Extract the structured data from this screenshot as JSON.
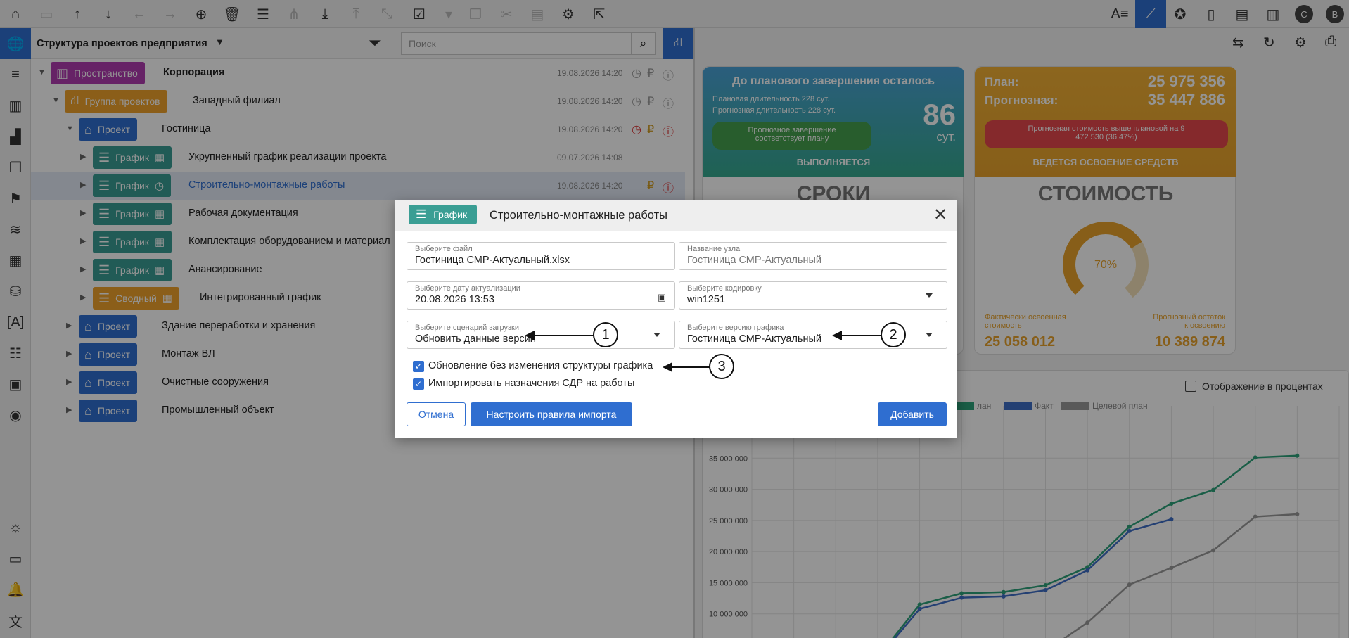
{
  "toolbar": {
    "icons": [
      "home-icon",
      "open-folder-icon",
      "move-up-icon",
      "move-down-icon",
      "undo-icon",
      "redo-icon",
      "add-icon",
      "delete-icon",
      "settings-sliders-icon",
      "hierarchy-icon",
      "download-icon",
      "upload-icon",
      "collapse-icon",
      "checkbox-icon",
      "copy-icon",
      "cut-icon",
      "paste-icon",
      "tools-icon",
      "export-icon"
    ],
    "right_badges": [
      "C",
      "B"
    ]
  },
  "tree_panel": {
    "selector_label": "Структура проектов предприятия",
    "search_placeholder": "Поиск",
    "rows": [
      {
        "type": "Пространство",
        "label": "Корпорация",
        "date": "19.08.2026 14:20",
        "bold": true
      },
      {
        "type": "Группа проектов",
        "label": "Западный филиал",
        "date": "19.08.2026 14:20"
      },
      {
        "type": "Проект",
        "label": "Гостиница",
        "date": "19.08.2026 14:20"
      },
      {
        "type": "График",
        "label": "Укрупненный график реализации проекта",
        "date": "09.07.2026 14:08"
      },
      {
        "type": "График",
        "label": "Строительно-монтажные работы",
        "date": "19.08.2026 14:20"
      },
      {
        "type": "График",
        "label": "Рабочая документация",
        "date": ""
      },
      {
        "type": "График",
        "label": "Комплектация оборудованием и материал",
        "date": ""
      },
      {
        "type": "График",
        "label": "Авансирование",
        "date": ""
      },
      {
        "type": "Сводный",
        "label": "Интегрированный график",
        "date": ""
      },
      {
        "type": "Проект",
        "label": "Здание переработки и хранения",
        "date": ""
      },
      {
        "type": "Проект",
        "label": "Монтаж ВЛ",
        "date": ""
      },
      {
        "type": "Проект",
        "label": "Очистные сооружения",
        "date": ""
      },
      {
        "type": "Проект",
        "label": "Промышленный объект",
        "date": ""
      }
    ]
  },
  "dashboard": {
    "term_card": {
      "title": "До планового завершения осталось",
      "planned": "Плановая длительность 228 сут.",
      "forecast": "Прогнозная длительность 228 сут.",
      "days": "86",
      "unit": "сут.",
      "status_pill": "Прогнозное завершение соответствует плану",
      "state": "ВЫПОЛНЯЕТСЯ",
      "section": "СРОКИ"
    },
    "cost_card": {
      "plan_label": "План:",
      "plan_value": "25 975 356",
      "forecast_label": "Прогнозная:",
      "forecast_value": "35 447 886",
      "status_pill": "Прогнозная стоимость выше плановой на 9 472 530 (36,47%)",
      "state": "ВЕДЕТСЯ ОСВОЕНИЕ СРЕДСТВ",
      "section": "СТОИМОСТЬ",
      "gauge_percent": "70%",
      "gauge_fraction": 0.7,
      "actual_label": "Фактически освоенная стоимость",
      "actual_value": "25 058 012",
      "remain_label": "Прогнозный остаток к освоению",
      "remain_value": "10 389 874"
    },
    "chart_options": {
      "percent_toggle": "Отображение в процентах"
    }
  },
  "chart_data": {
    "type": "line",
    "title": "",
    "xlabel": "",
    "ylabel": "",
    "ylim": [
      0,
      40000000
    ],
    "yticks": [
      "10 000 000",
      "15 000 000",
      "20 000 000",
      "25 000 000",
      "30 000 000",
      "35 000 000"
    ],
    "legend": [
      "лан",
      "Факт",
      "Целевой план"
    ],
    "x": [
      1,
      2,
      3,
      4,
      5,
      6,
      7,
      8,
      9,
      10,
      11,
      12,
      13,
      14,
      15
    ],
    "series": [
      {
        "name": "лан",
        "color": "#2ea37a",
        "values": [
          null,
          null,
          null,
          3000000,
          11500000,
          13300000,
          13500000,
          14600000,
          17500000,
          24000000,
          27700000,
          29900000,
          35100000,
          35400000,
          null
        ]
      },
      {
        "name": "Факт",
        "color": "#3f6fc7",
        "values": [
          null,
          null,
          null,
          2800000,
          10800000,
          12600000,
          12800000,
          13800000,
          17000000,
          23300000,
          25200000,
          null,
          null,
          null,
          null
        ]
      },
      {
        "name": "Целевой план",
        "color": "#9a9a9a",
        "values": [
          null,
          null,
          null,
          null,
          null,
          null,
          null,
          4000000,
          8600000,
          14700000,
          17400000,
          20200000,
          25600000,
          26000000,
          null
        ]
      }
    ]
  },
  "dialog": {
    "badge": "График",
    "title": "Строительно-монтажные работы",
    "file_label": "Выберите файл",
    "file_value": "Гостиница СМР-Актуальный.xlsx",
    "node_label": "Название узла",
    "node_value": "Гостиница СМР-Актуальный",
    "date_label": "Выберите дату актуализации",
    "date_value": "20.08.2026 13:53",
    "encoding_label": "Выберите кодировку",
    "encoding_value": "win1251",
    "scenario_label": "Выберите сценарий загрузки",
    "scenario_value": "Обновить данные версии",
    "version_label": "Выберите версию графика",
    "version_value": "Гостиница СМР-Актуальный",
    "check1": "Обновление без изменения структуры графика",
    "check2": "Импортировать назначения СДР на работы",
    "cancel": "Отмена",
    "rules": "Настроить правила импорта",
    "add": "Добавить"
  },
  "callouts": [
    "1",
    "2",
    "3"
  ]
}
